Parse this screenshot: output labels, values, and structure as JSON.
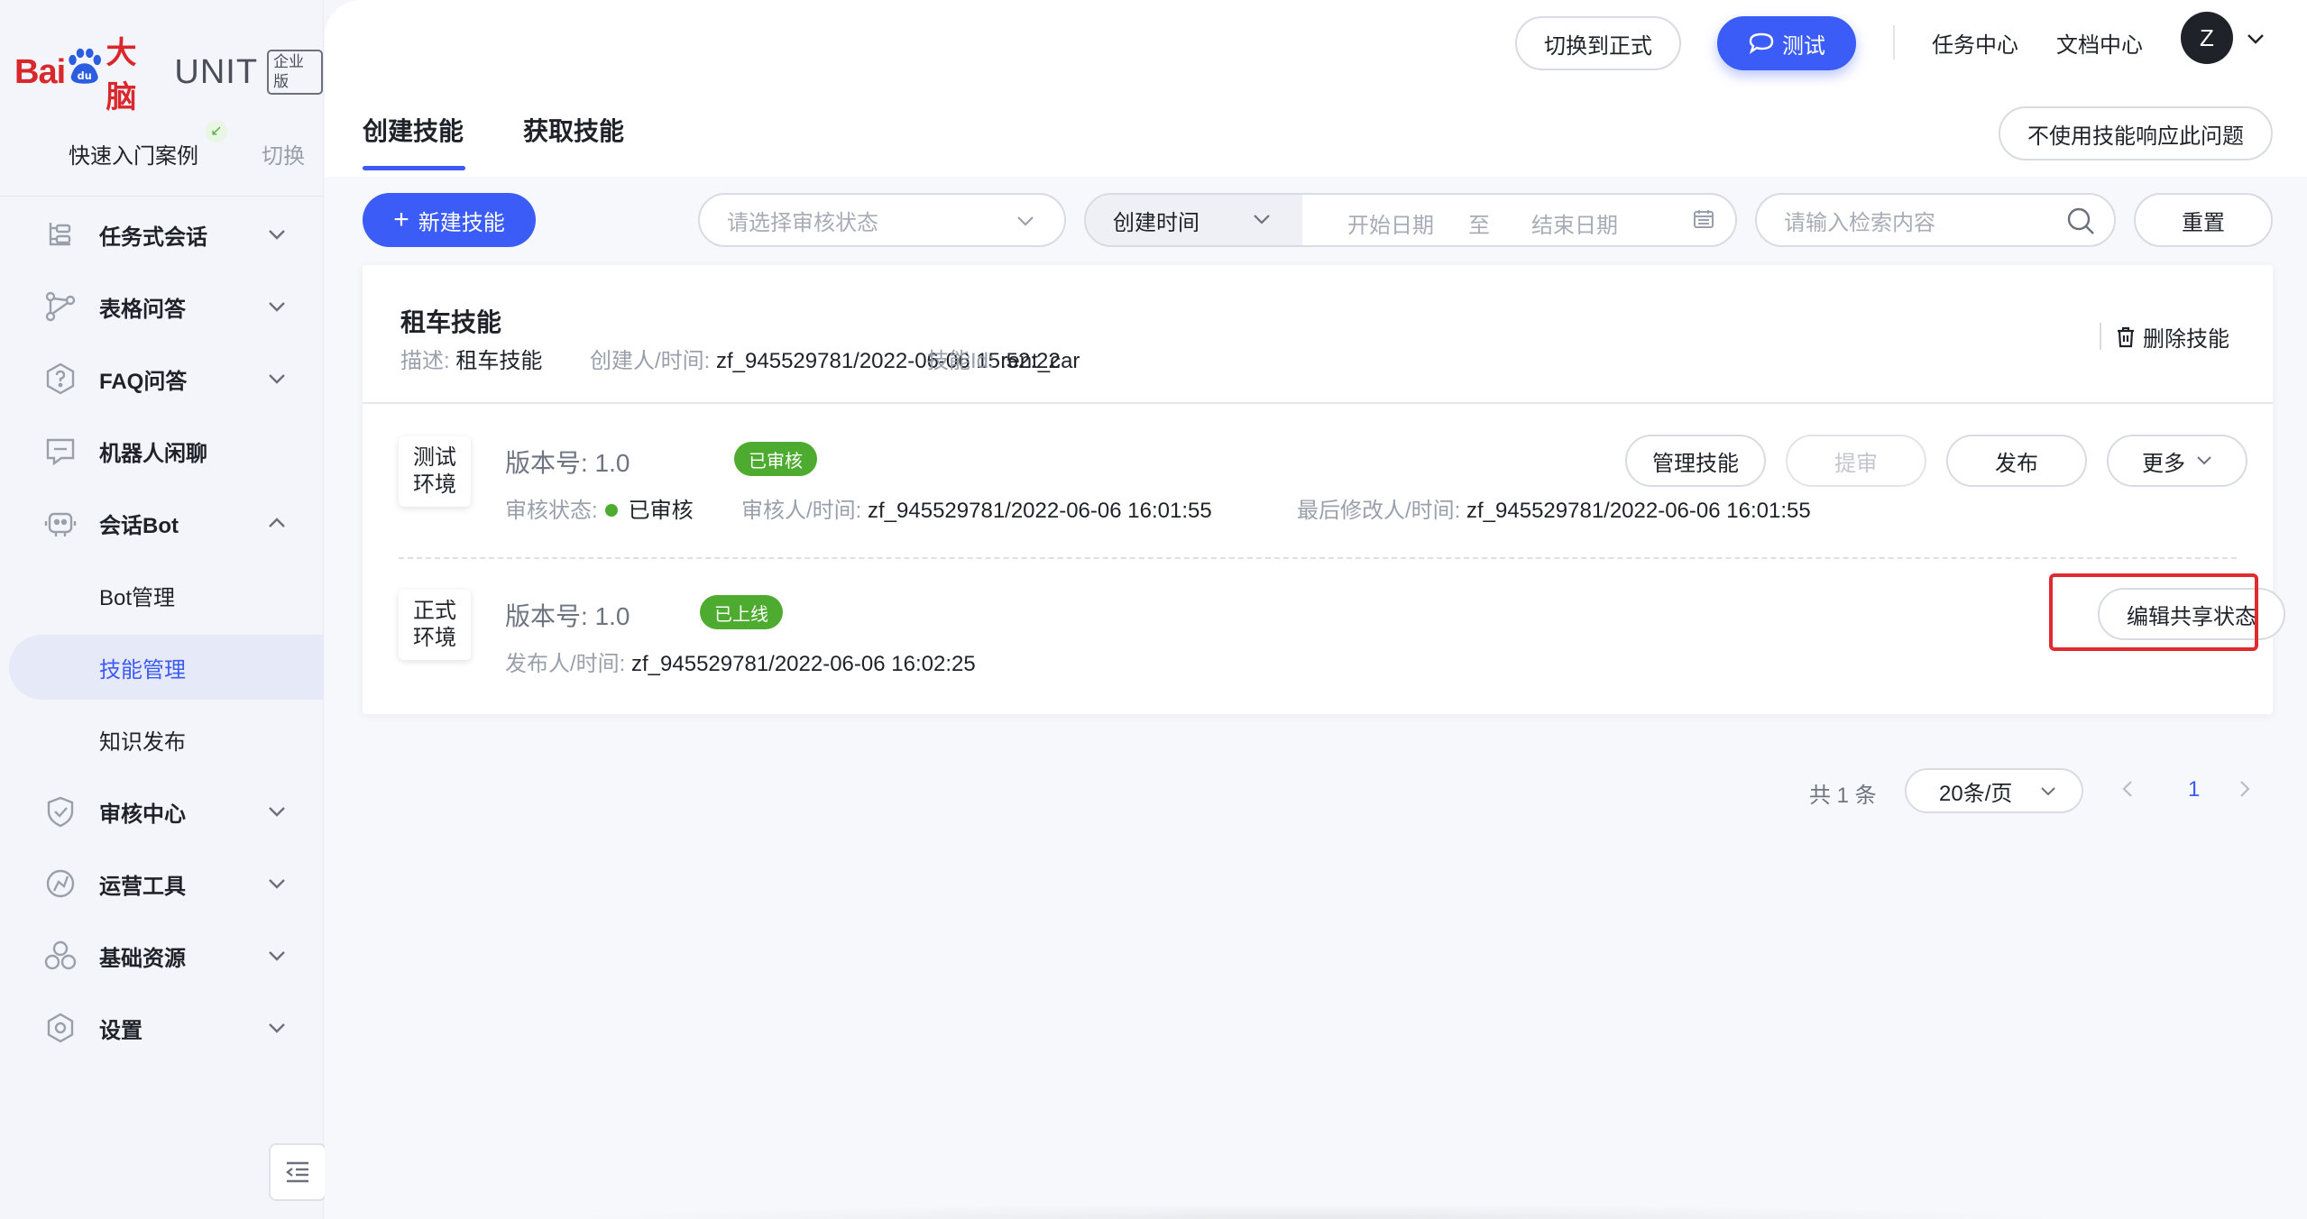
{
  "brand": {
    "bai": "Bai",
    "du": "du",
    "danao": "大脑",
    "unit": "UNIT",
    "edition": "企业版"
  },
  "sidebar": {
    "quick_case": "快速入门案例",
    "switch": "切换",
    "items": [
      {
        "label": "任务式会话",
        "icon": "task-dialog-icon",
        "expanded": false
      },
      {
        "label": "表格问答",
        "icon": "table-qa-icon",
        "expanded": false
      },
      {
        "label": "FAQ问答",
        "icon": "faq-icon",
        "expanded": false
      },
      {
        "label": "机器人闲聊",
        "icon": "chat-icon",
        "expanded": false
      },
      {
        "label": "会话Bot",
        "icon": "bot-icon",
        "expanded": true
      },
      {
        "label": "审核中心",
        "icon": "shield-check-icon",
        "expanded": false
      },
      {
        "label": "运营工具",
        "icon": "operation-tool-icon",
        "expanded": false
      },
      {
        "label": "基础资源",
        "icon": "resource-icon",
        "expanded": false
      },
      {
        "label": "设置",
        "icon": "settings-icon",
        "expanded": false
      }
    ],
    "sub_items": [
      {
        "label": "Bot管理",
        "active": false
      },
      {
        "label": "技能管理",
        "active": true
      },
      {
        "label": "知识发布",
        "active": false
      }
    ]
  },
  "topbar": {
    "switch_formal": "切换到正式",
    "test": "测试",
    "task_center": "任务中心",
    "doc_center": "文档中心",
    "avatar_letter": "Z"
  },
  "tabs": [
    {
      "label": "创建技能",
      "active": true
    },
    {
      "label": "获取技能",
      "active": false
    }
  ],
  "no_skill_button": "不使用技能响应此问题",
  "filters": {
    "new_skill": "新建技能",
    "audit_placeholder": "请选择审核状态",
    "date_type": "创建时间",
    "start_date": "开始日期",
    "to": "至",
    "end_date": "结束日期",
    "search_placeholder": "请输入检索内容",
    "reset": "重置"
  },
  "skill": {
    "name": "租车技能",
    "desc_label": "描述:",
    "desc_value": "租车技能",
    "creator_label": "创建人/时间:",
    "creator_value": "zf_945529781/2022-06-06 15:52:22",
    "id_label": "技能Id:",
    "id_value": "rent_car",
    "delete": "删除技能",
    "test_env": {
      "tag_line1": "测试",
      "tag_line2": "环境",
      "version": "版本号: 1.0",
      "badge": "已审核",
      "audit_label": "审核状态:",
      "audit_value": "已审核",
      "auditor_label": "审核人/时间:",
      "auditor_value": "zf_945529781/2022-06-06 16:01:55",
      "modifier_label": "最后修改人/时间:",
      "modifier_value": "zf_945529781/2022-06-06 16:01:55",
      "btn_manage": "管理技能",
      "btn_submit": "提审",
      "btn_publish": "发布",
      "btn_more": "更多"
    },
    "prod_env": {
      "tag_line1": "正式",
      "tag_line2": "环境",
      "version": "版本号: 1.0",
      "badge": "已上线",
      "publisher_label": "发布人/时间:",
      "publisher_value": "zf_945529781/2022-06-06 16:02:25",
      "btn_edit_share": "编辑共享状态"
    }
  },
  "pagination": {
    "total": "共 1 条",
    "page_size": "20条/页",
    "current": "1"
  },
  "colors": {
    "primary": "#3b5cf6",
    "success": "#4dab2f",
    "highlight": "#e02a31",
    "brand_red": "#d9282c"
  }
}
